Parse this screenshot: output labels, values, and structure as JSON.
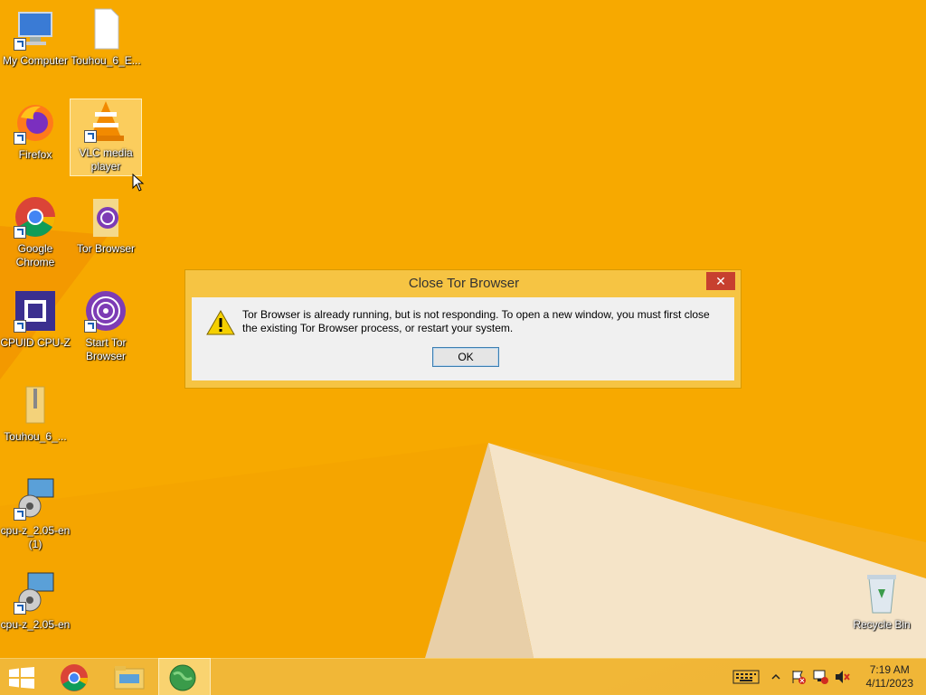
{
  "desktop": {
    "icons": [
      {
        "label": "My Computer",
        "icon": "computer-icon"
      },
      {
        "label": "Touhou_6_E...",
        "icon": "document-icon"
      },
      {
        "label": "Firefox",
        "icon": "firefox-icon"
      },
      {
        "label": "VLC media player",
        "icon": "vlc-icon",
        "selected": true
      },
      {
        "label": "Google Chrome",
        "icon": "chrome-icon"
      },
      {
        "label": "Tor Browser",
        "icon": "tor-folder-icon"
      },
      {
        "label": "CPUID CPU-Z",
        "icon": "cpuz-icon"
      },
      {
        "label": "Start Tor Browser",
        "icon": "tor-icon"
      },
      {
        "label": "Touhou_6_...",
        "icon": "zip-folder-icon"
      },
      {
        "label": "cpu-z_2.05-en (1)",
        "icon": "installer-icon"
      },
      {
        "label": "cpu-z_2.05-en",
        "icon": "installer-icon"
      },
      {
        "label": "Recycle Bin",
        "icon": "recycle-bin-icon"
      }
    ]
  },
  "dialog": {
    "title": "Close Tor Browser",
    "close_glyph": "✕",
    "message": "Tor Browser is already running, but is not responding. To open a new window, you must first close the existing Tor Browser process, or restart your system.",
    "ok_label": "OK",
    "icon": "warning-icon"
  },
  "taskbar": {
    "items": [
      "start-button",
      "chrome-taskbar-icon",
      "file-explorer-taskbar-icon",
      "tor-taskbar-icon"
    ],
    "tray": [
      "keyboard-icon",
      "show-hidden-icons-chevron",
      "action-center-flag-icon",
      "network-icon",
      "volume-muted-icon"
    ],
    "time": "7:19 AM",
    "date": "4/11/2023"
  },
  "colors": {
    "accent": "#f6a800",
    "dialog_frame": "#f6c443",
    "close_red": "#c7402f"
  }
}
